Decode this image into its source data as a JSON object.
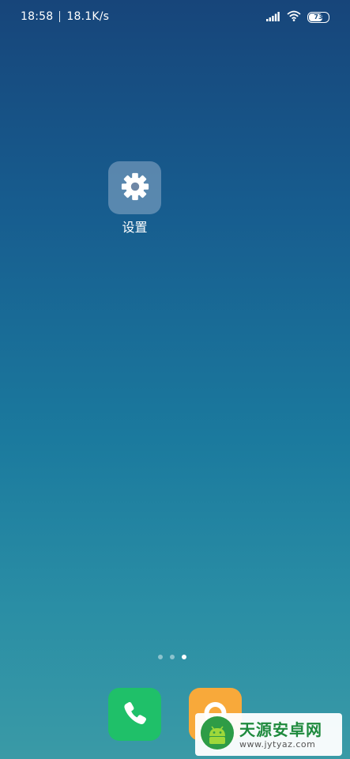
{
  "status_bar": {
    "time": "18:58",
    "net_speed": "18.1K/s",
    "battery_level": "73",
    "battery_fraction": 0.73,
    "signal_icon": "signal-icon",
    "wifi_icon": "wifi-icon"
  },
  "home": {
    "apps": [
      {
        "label": "设置",
        "icon": "gear-icon"
      }
    ],
    "page_indicator": {
      "count": 3,
      "active_index": 2
    }
  },
  "dock": {
    "apps": [
      {
        "icon": "phone-icon",
        "color": "#1fc069"
      },
      {
        "icon": "lock-icon",
        "color": "#f8a93a"
      }
    ]
  },
  "watermark": {
    "title": "天源安卓网",
    "url": "www.jytyaz.com"
  }
}
